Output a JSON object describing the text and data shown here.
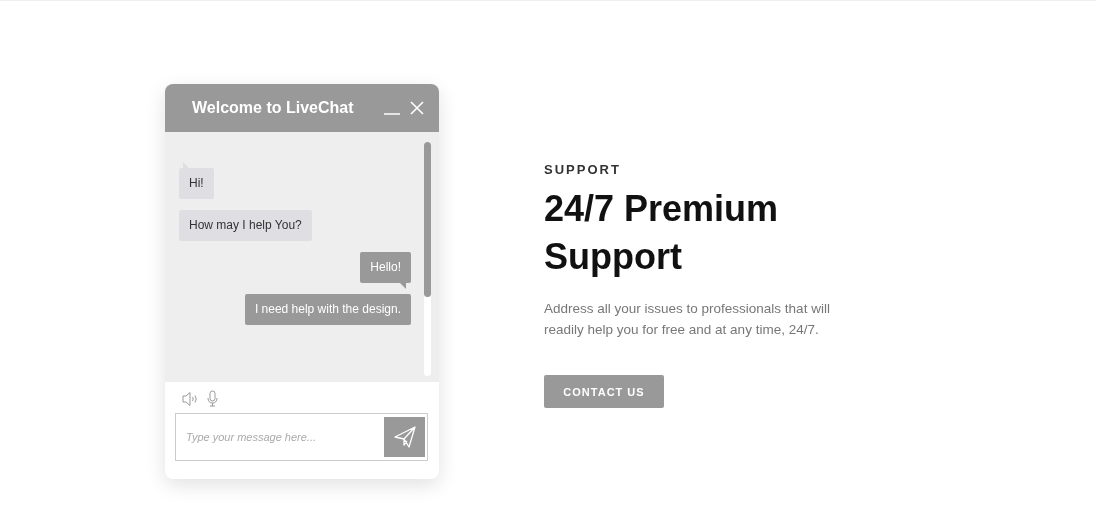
{
  "chat_widget": {
    "title": "Welcome to LiveChat",
    "messages": [
      {
        "text": "Hi!",
        "kind": "incoming",
        "tail": true
      },
      {
        "text": "How may I help You?",
        "kind": "incoming",
        "tail": false
      },
      {
        "text": "Hello!",
        "kind": "outgoing",
        "tail": true
      },
      {
        "text": "I need help with the design.",
        "kind": "outgoing",
        "tail": false
      }
    ],
    "input": {
      "placeholder": "Type your message here..."
    }
  },
  "section": {
    "eyebrow": "SUPPORT",
    "heading": "24/7 Premium Support",
    "description": "Address all your issues to professionals that will readily help you for free and at any time, 24/7.",
    "button": "CONTACT US"
  }
}
